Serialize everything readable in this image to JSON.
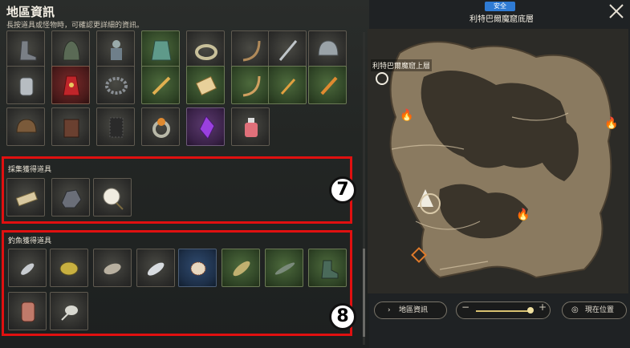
{
  "panel": {
    "title": "地區資訊",
    "subtitle": "長按道具或怪物時，可確認更詳細的資訊。"
  },
  "drops": {
    "row1_icons": [
      "boots-icon",
      "hood-icon",
      "armor-figure-icon",
      "green-cloak-icon",
      "ring-icon",
      "bow-icon",
      "spear-icon",
      "helmet-icon"
    ],
    "row2_icons": [
      "gauntlet-icon",
      "red-robe-icon",
      "chain-ring-icon",
      "sword-icon",
      "scroll-icon",
      "bow-icon",
      "dagger-icon",
      "sword-icon"
    ],
    "row3_icons": [
      "fur-hat-icon",
      "leather-armor-icon",
      "dark-coat-icon",
      "amber-ring-icon",
      "purple-crystal-icon",
      "potion-icon"
    ]
  },
  "gathering": {
    "label": "採集獲得道具",
    "icons": [
      "plank-icon",
      "ore-icon",
      "cotton-icon"
    ],
    "badge": "7"
  },
  "fishing": {
    "label": "釣魚獲得道具",
    "icons": [
      "small-fish-icon",
      "yellow-fish-icon",
      "fish-icon",
      "silver-fish-icon",
      "lionfish-icon",
      "green-fish-icon",
      "eel-icon",
      "boot-icon",
      "meat-icon",
      "crab-icon"
    ],
    "badge": "8"
  },
  "map": {
    "safety_tag": "安全",
    "area_name": "利特巴爾魔窟底層",
    "portal_label": "利特巴爾魔窟上層",
    "area_info_button": "地區資訊",
    "current_position_button": "現在位置",
    "zoom_level": 0.8
  },
  "colors": {
    "highlight_box": "#e01010",
    "safe_tag": "#2f7bd4"
  }
}
